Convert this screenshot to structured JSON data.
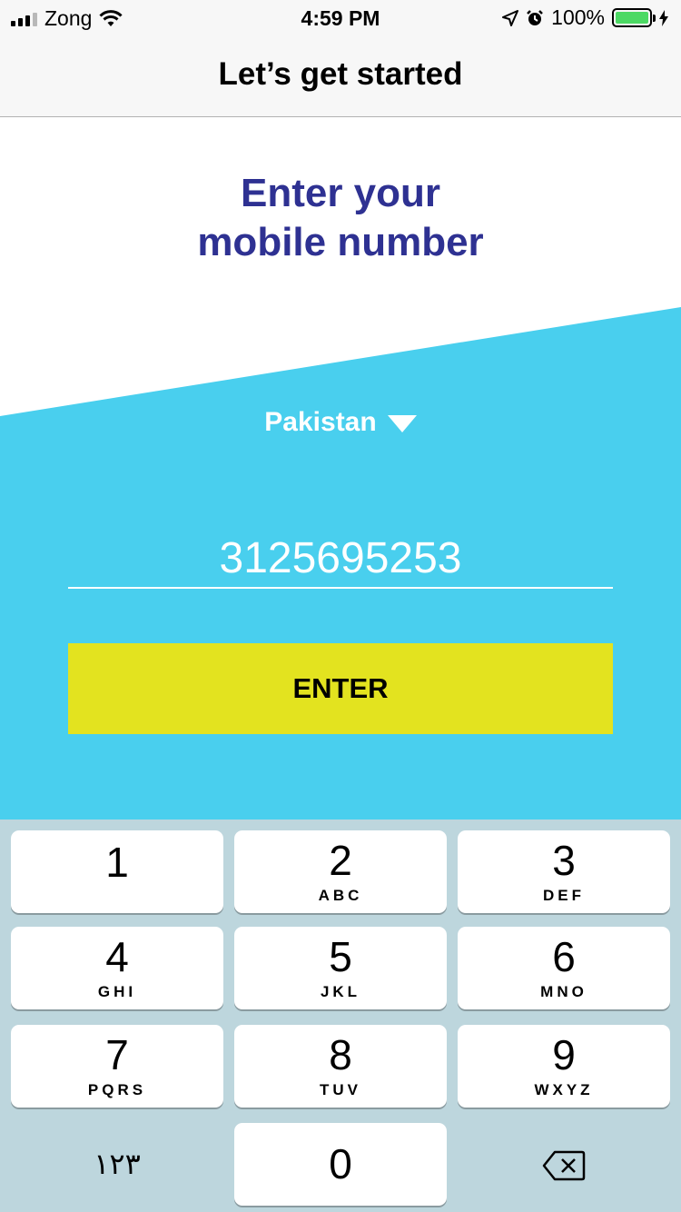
{
  "status_bar": {
    "carrier": "Zong",
    "time": "4:59 PM",
    "battery": "100%",
    "icons": [
      "signal-icon",
      "wifi-icon",
      "location-icon",
      "alarm-icon",
      "battery-icon",
      "charging-icon"
    ]
  },
  "nav": {
    "title": "Let’s get started"
  },
  "heading": {
    "line1": "Enter your",
    "line2": "mobile number"
  },
  "country": {
    "label": "Pakistan"
  },
  "phone_input": {
    "value": "3125695253"
  },
  "enter_button": {
    "label": "ENTER"
  },
  "keypad": {
    "keys": [
      {
        "num": "1",
        "letters": ""
      },
      {
        "num": "2",
        "letters": "ABC"
      },
      {
        "num": "3",
        "letters": "DEF"
      },
      {
        "num": "4",
        "letters": "GHI"
      },
      {
        "num": "5",
        "letters": "JKL"
      },
      {
        "num": "6",
        "letters": "MNO"
      },
      {
        "num": "7",
        "letters": "PQRS"
      },
      {
        "num": "8",
        "letters": "TUV"
      },
      {
        "num": "9",
        "letters": "WXYZ"
      },
      {
        "num": "0",
        "letters": ""
      }
    ],
    "alt_label": "١٢٣"
  },
  "colors": {
    "accent_blue": "#49cfee",
    "heading_navy": "#2e3192",
    "button_yellow": "#e3e31f",
    "keypad_bg": "#bdd6dd",
    "battery_green": "#4cd964"
  }
}
